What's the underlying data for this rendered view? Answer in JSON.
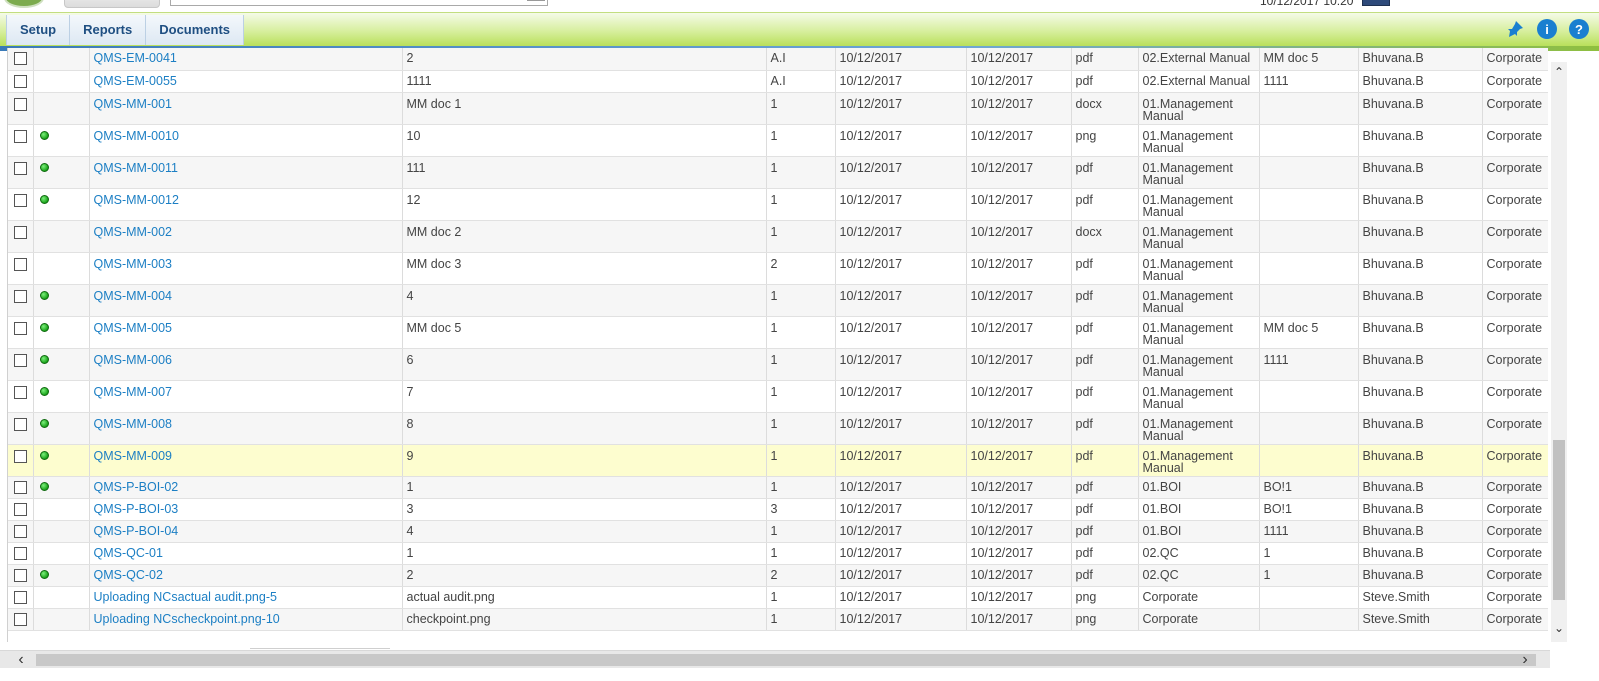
{
  "topbar": {
    "mini_text": "………………",
    "date_time": "10/12/2017 10:20"
  },
  "menu": {
    "items": [
      {
        "label": "Setup"
      },
      {
        "label": "Reports"
      },
      {
        "label": "Documents"
      }
    ]
  },
  "icons": {
    "pin": "pin-icon",
    "info": "info-icon",
    "help": "help-icon",
    "info_glyph": "i",
    "help_glyph": "?"
  },
  "colors": {
    "link": "#1c7fc4",
    "highlight_row": "#fdfdcf",
    "status_dot": "#19a219",
    "nav_green": "#b9e05b"
  },
  "table": {
    "rows": [
      {
        "id": "QMS-EM-0041",
        "dot": false,
        "title": "2",
        "rev": "A.I",
        "d1": "10/12/2017",
        "d2": "10/12/2017",
        "type": "pdf",
        "category": "02.External Manual",
        "ref": "MM doc 5",
        "owner": "Bhuvana.B",
        "org": "Corporate"
      },
      {
        "id": "QMS-EM-0055",
        "dot": false,
        "title": "1111",
        "rev": "A.I",
        "d1": "10/12/2017",
        "d2": "10/12/2017",
        "type": "pdf",
        "category": "02.External Manual",
        "ref": "1111",
        "owner": "Bhuvana.B",
        "org": "Corporate"
      },
      {
        "id": "QMS-MM-001",
        "dot": false,
        "title": "MM doc 1",
        "rev": "1",
        "d1": "10/12/2017",
        "d2": "10/12/2017",
        "type": "docx",
        "category": "01.Management Manual",
        "ref": "",
        "owner": "Bhuvana.B",
        "org": "Corporate"
      },
      {
        "id": "QMS-MM-0010",
        "dot": true,
        "title": "10",
        "rev": "1",
        "d1": "10/12/2017",
        "d2": "10/12/2017",
        "type": "png",
        "category": "01.Management Manual",
        "ref": "",
        "owner": "Bhuvana.B",
        "org": "Corporate"
      },
      {
        "id": "QMS-MM-0011",
        "dot": true,
        "title": "111",
        "rev": "1",
        "d1": "10/12/2017",
        "d2": "10/12/2017",
        "type": "pdf",
        "category": "01.Management Manual",
        "ref": "",
        "owner": "Bhuvana.B",
        "org": "Corporate"
      },
      {
        "id": "QMS-MM-0012",
        "dot": true,
        "title": "12",
        "rev": "1",
        "d1": "10/12/2017",
        "d2": "10/12/2017",
        "type": "pdf",
        "category": "01.Management Manual",
        "ref": "",
        "owner": "Bhuvana.B",
        "org": "Corporate"
      },
      {
        "id": "QMS-MM-002",
        "dot": false,
        "title": "MM doc 2",
        "rev": "1",
        "d1": "10/12/2017",
        "d2": "10/12/2017",
        "type": "docx",
        "category": "01.Management Manual",
        "ref": "",
        "owner": "Bhuvana.B",
        "org": "Corporate"
      },
      {
        "id": "QMS-MM-003",
        "dot": false,
        "title": "MM doc 3",
        "rev": "2",
        "d1": "10/12/2017",
        "d2": "10/12/2017",
        "type": "pdf",
        "category": "01.Management Manual",
        "ref": "",
        "owner": "Bhuvana.B",
        "org": "Corporate"
      },
      {
        "id": "QMS-MM-004",
        "dot": true,
        "title": "4",
        "rev": "1",
        "d1": "10/12/2017",
        "d2": "10/12/2017",
        "type": "pdf",
        "category": "01.Management Manual",
        "ref": "",
        "owner": "Bhuvana.B",
        "org": "Corporate"
      },
      {
        "id": "QMS-MM-005",
        "dot": true,
        "title": "MM doc 5",
        "rev": "1",
        "d1": "10/12/2017",
        "d2": "10/12/2017",
        "type": "pdf",
        "category": "01.Management Manual",
        "ref": "MM doc 5",
        "owner": "Bhuvana.B",
        "org": "Corporate"
      },
      {
        "id": "QMS-MM-006",
        "dot": true,
        "title": "6",
        "rev": "1",
        "d1": "10/12/2017",
        "d2": "10/12/2017",
        "type": "pdf",
        "category": "01.Management Manual",
        "ref": "1111",
        "owner": "Bhuvana.B",
        "org": "Corporate"
      },
      {
        "id": "QMS-MM-007",
        "dot": true,
        "title": "7",
        "rev": "1",
        "d1": "10/12/2017",
        "d2": "10/12/2017",
        "type": "pdf",
        "category": "01.Management Manual",
        "ref": "",
        "owner": "Bhuvana.B",
        "org": "Corporate"
      },
      {
        "id": "QMS-MM-008",
        "dot": true,
        "title": "8",
        "rev": "1",
        "d1": "10/12/2017",
        "d2": "10/12/2017",
        "type": "pdf",
        "category": "01.Management Manual",
        "ref": "",
        "owner": "Bhuvana.B",
        "org": "Corporate"
      },
      {
        "id": "QMS-MM-009",
        "dot": true,
        "title": "9",
        "rev": "1",
        "d1": "10/12/2017",
        "d2": "10/12/2017",
        "type": "pdf",
        "category": "01.Management Manual",
        "ref": "",
        "owner": "Bhuvana.B",
        "org": "Corporate",
        "highlight": true
      },
      {
        "id": "QMS-P-BOI-02",
        "dot": true,
        "title": "1",
        "rev": "1",
        "d1": "10/12/2017",
        "d2": "10/12/2017",
        "type": "pdf",
        "category": "01.BOI",
        "ref": "BO!1",
        "owner": "Bhuvana.B",
        "org": "Corporate"
      },
      {
        "id": "QMS-P-BOI-03",
        "dot": false,
        "title": "3",
        "rev": "3",
        "d1": "10/12/2017",
        "d2": "10/12/2017",
        "type": "pdf",
        "category": "01.BOI",
        "ref": "BO!1",
        "owner": "Bhuvana.B",
        "org": "Corporate"
      },
      {
        "id": "QMS-P-BOI-04",
        "dot": false,
        "title": "4",
        "rev": "1",
        "d1": "10/12/2017",
        "d2": "10/12/2017",
        "type": "pdf",
        "category": "01.BOI",
        "ref": "1111",
        "owner": "Bhuvana.B",
        "org": "Corporate"
      },
      {
        "id": "QMS-QC-01",
        "dot": false,
        "title": "1",
        "rev": "1",
        "d1": "10/12/2017",
        "d2": "10/12/2017",
        "type": "pdf",
        "category": "02.QC",
        "ref": "1",
        "owner": "Bhuvana.B",
        "org": "Corporate"
      },
      {
        "id": "QMS-QC-02",
        "dot": true,
        "title": "2",
        "rev": "2",
        "d1": "10/12/2017",
        "d2": "10/12/2017",
        "type": "pdf",
        "category": "02.QC",
        "ref": "1",
        "owner": "Bhuvana.B",
        "org": "Corporate"
      },
      {
        "id": "Uploading NCsactual audit.png-5",
        "dot": false,
        "title": "actual audit.png",
        "rev": "1",
        "d1": "10/12/2017",
        "d2": "10/12/2017",
        "type": "png",
        "category": "Corporate",
        "ref": "",
        "owner": "Steve.Smith",
        "org": "Corporate"
      },
      {
        "id": "Uploading NCscheckpoint.png-10",
        "dot": false,
        "title": "checkpoint.png",
        "rev": "1",
        "d1": "10/12/2017",
        "d2": "10/12/2017",
        "type": "png",
        "category": "Corporate",
        "ref": "",
        "owner": "Steve.Smith",
        "org": "Corporate"
      }
    ]
  }
}
